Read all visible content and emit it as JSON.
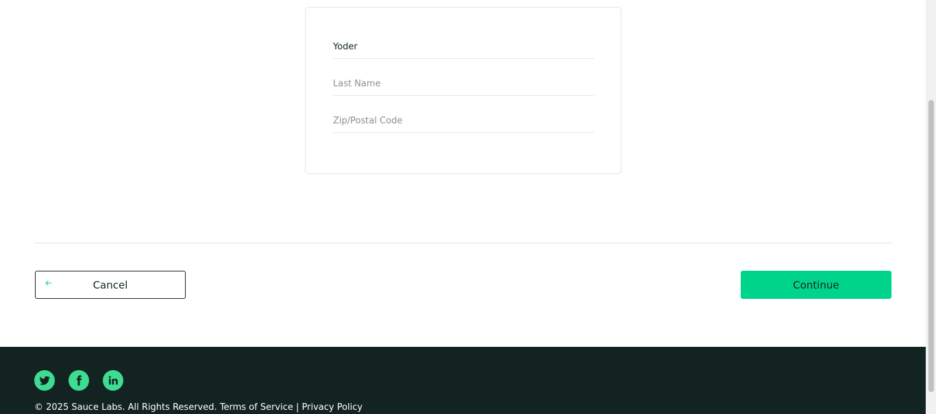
{
  "checkout_form": {
    "first_name_value": "Yoder",
    "last_name_placeholder": "Last Name",
    "zip_placeholder": "Zip/Postal Code"
  },
  "actions": {
    "cancel_label": "Cancel",
    "continue_label": "Continue"
  },
  "footer": {
    "social_icons": [
      "twitter-icon",
      "facebook-icon",
      "linkedin-icon"
    ],
    "copyright": "© 2025 Sauce Labs. All Rights Reserved. Terms of Service | Privacy Policy"
  },
  "colors": {
    "accent": "#3ddc91",
    "footer_bg": "#132322",
    "text": "#132322",
    "border": "#e5e5e5"
  }
}
